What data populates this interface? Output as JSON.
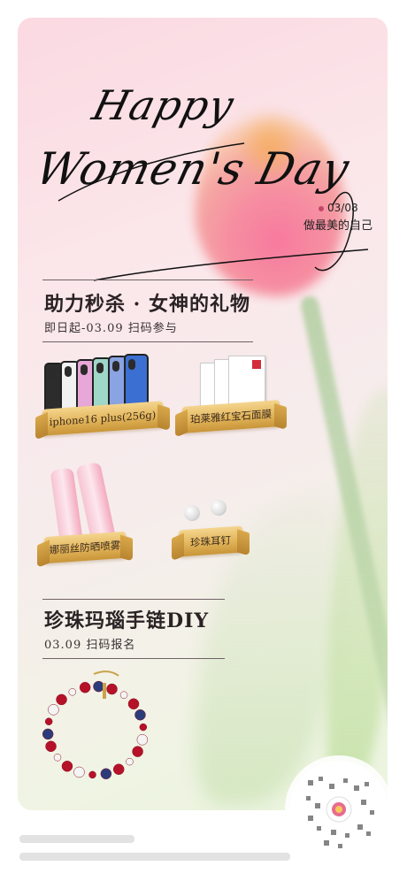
{
  "header": {
    "script_line1": "Happy",
    "script_line2": "Women's Day",
    "date": "03/08",
    "tagline": "做最美的自己"
  },
  "flash_sale": {
    "title": "助力秒杀 · 女神的礼物",
    "subtitle": "即日起-03.09 扫码参与",
    "products": [
      {
        "label": "iphone16 plus(256g)",
        "icon": "phone-icon"
      },
      {
        "label": "珀莱雅红宝石面膜",
        "icon": "face-mask-icon"
      },
      {
        "label": "娜丽丝防晒喷雾",
        "icon": "sunscreen-spray-icon"
      },
      {
        "label": "珍珠耳钉",
        "icon": "pearl-earring-icon"
      }
    ]
  },
  "diy": {
    "title": "珍珠玛瑙手链DIY",
    "subtitle": "03.09 扫码报名",
    "icon": "bracelet-icon"
  },
  "colors": {
    "accent": "#c4456a",
    "ribbon_gold": "#e2b45a",
    "text_dark": "#2a2224"
  }
}
